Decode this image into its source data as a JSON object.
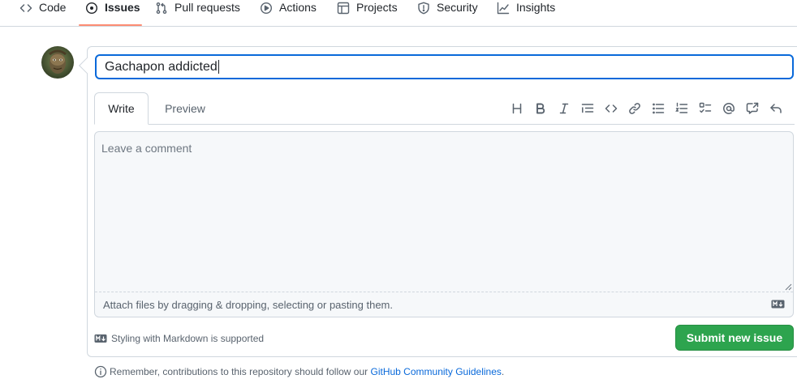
{
  "nav": {
    "items": [
      {
        "label": "Code",
        "icon": "code-icon"
      },
      {
        "label": "Issues",
        "icon": "issue-opened-icon",
        "selected": true
      },
      {
        "label": "Pull requests",
        "icon": "git-pull-request-icon"
      },
      {
        "label": "Actions",
        "icon": "play-icon"
      },
      {
        "label": "Projects",
        "icon": "table-icon"
      },
      {
        "label": "Security",
        "icon": "shield-icon"
      },
      {
        "label": "Insights",
        "icon": "graph-icon"
      }
    ],
    "accent": "#fd8c73"
  },
  "form": {
    "title_value": "Gachapon addicted",
    "tabs": {
      "write": "Write",
      "preview": "Preview"
    },
    "toolbar": [
      "heading-icon",
      "bold-icon",
      "italic-icon",
      "quote-icon",
      "code-icon",
      "link-icon",
      "unordered-list-icon",
      "ordered-list-icon",
      "tasklist-icon",
      "mention-icon",
      "cross-reference-icon",
      "reply-icon"
    ],
    "comment_placeholder": "Leave a comment",
    "attach_hint": "Attach files by dragging & dropping, selecting or pasting them.",
    "markdown_note": "Styling with Markdown is supported",
    "submit_label": "Submit new issue",
    "submit_color": "#2da44e"
  },
  "guideline": {
    "text": "Remember, contributions to this repository should follow our",
    "link": "GitHub Community Guidelines",
    "end": "."
  }
}
